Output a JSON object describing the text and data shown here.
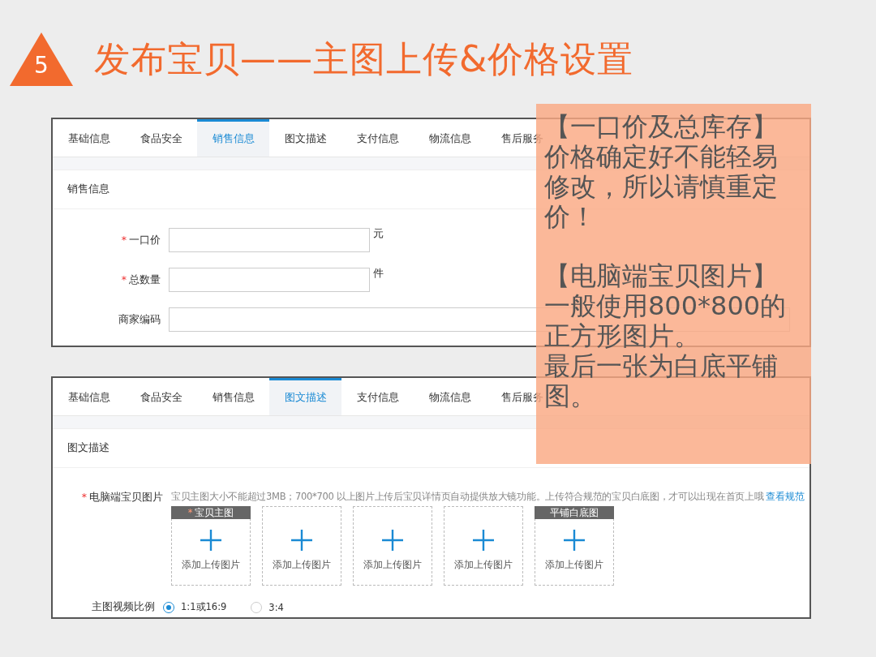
{
  "slide": {
    "number": "5",
    "title": "发布宝贝——主图上传&价格设置"
  },
  "sales_panel": {
    "tabs": [
      {
        "label": "基础信息",
        "selected": false
      },
      {
        "label": "食品安全",
        "selected": false
      },
      {
        "label": "销售信息",
        "selected": true
      },
      {
        "label": "图文描述",
        "selected": false
      },
      {
        "label": "支付信息",
        "selected": false
      },
      {
        "label": "物流信息",
        "selected": false
      },
      {
        "label": "售后服务",
        "selected": false
      }
    ],
    "section": "销售信息",
    "fields": [
      {
        "label": "一口价",
        "required_mark": "*",
        "unit": "元",
        "kind": "short"
      },
      {
        "label": "总数量",
        "required_mark": "*",
        "unit": "件",
        "kind": "short"
      },
      {
        "label": "商家编码",
        "kind": "long"
      }
    ]
  },
  "image_panel": {
    "tabs": [
      {
        "label": "基础信息",
        "selected": false
      },
      {
        "label": "食品安全",
        "selected": false
      },
      {
        "label": "销售信息",
        "selected": false
      },
      {
        "label": "图文描述",
        "selected": true
      },
      {
        "label": "支付信息",
        "selected": false
      },
      {
        "label": "物流信息",
        "selected": false
      },
      {
        "label": "售后服务",
        "selected": false
      }
    ],
    "section": "图文描述",
    "images": {
      "label": "电脑端宝贝图片",
      "required_mark": "*",
      "hint": "宝贝主图大小不能超过3MB；700*700 以上图片上传后宝贝详情页自动提供放大镜功能。上传符合规范的宝贝白底图，才可以出现在首页上哦",
      "link": "查看规范",
      "slots": [
        {
          "tag": "宝贝主图",
          "required_mark": "*",
          "action": "添加上传图片"
        },
        {
          "action": "添加上传图片"
        },
        {
          "action": "添加上传图片"
        },
        {
          "action": "添加上传图片"
        },
        {
          "tag": "平铺白底图",
          "action": "添加上传图片"
        }
      ]
    },
    "ratio": {
      "label": "主图视频比例",
      "options": [
        {
          "label": "1:1或16:9",
          "selected": true
        },
        {
          "label": "3:4",
          "selected": false
        }
      ]
    }
  },
  "note": [
    "【一口价及总库存】价格确定好不能轻易修改，所以请慎重定价！",
    "【电脑端宝贝图片】一般使用800*800的正方形图片。",
    "最后一张为白底平铺图。"
  ]
}
